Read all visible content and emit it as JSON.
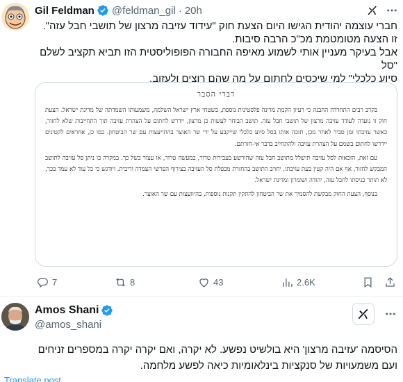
{
  "tweet1": {
    "author_name": "Gil Feldman",
    "handle": "@feldman_gil",
    "separator": "·",
    "time": "20h",
    "text_lines": [
      "חברי עוצמה יהודית הגישו היום הצעת חוק \"עידוד עזיבה מרצון של תושבי חבל עזה\".",
      "זו הצעה מטומטמת מכ\"כ הרבה סיבות.",
      "אבל בעיקר מעניין אותי לשמוע מאיפה החבורה הפופוליסטית הזו תביא תקציב לשלם \"סל",
      "סיוע כלכלי\" למי שיכסים לחתום על מה שהם רוצים ולעזוב."
    ],
    "document": {
      "title": "דברי הסבר",
      "paragraphs": [
        "בקרב רבים התחדדה ההבנה כי רעיון הקמת מדינה פלסטינית נוספת, בשטחי ארץ ישראל השלמה, משמעותו השמדתה של מדינת ישראל. הצעת חוק זו נועדה לעודד עזיבה מרצון של תושבי חבל עזה. תושב הבוחר לעשות כן מרצון, יידרש לחתום על הצהרת עזיבה תוך התחייבות שלא לחזור, כאשר עזיבתו זמן סביר לאחר מכן, תזכה אותו בסל סיוע כלכלי שייקבע על ידי שר האוצר בהתייעצות עם שר הביטחון. כמו כן, אחראים לקטינים יידרשו לחתום בשמם על הצהרת עזיבה ולהתחייב בדבר אי-חזרתם.",
        "עם זאת, הזכאות לסל עזיבה תישלל מתושב חבל עזה שהורשע בעבירות טרור, במעשה טרור, או עצור בשל כך. במקרה בו ניתן סל עזיבה לתושב המבקש לחזור, אף אם היה קטין בעת עזיבתו, יחויב התושב בהחזרת מכפלת סל העזיבה בצירוף הפרשי הצמדה וריבית. ויודגש כי כל עוד לא עמד בכך, לא תותר כניסתו לחבל עזה, יהודה ושומרון ומדינת ישראל.",
        "בנוסף, הצעת החוק מבקשת להסמיך את שר הביטחון להתקין תקנות נוספות, בהיוועצות עם שר האוצר."
      ]
    },
    "actions": {
      "replies": "7",
      "reposts": "8",
      "likes": "43",
      "views": "2.6K"
    }
  },
  "tweet2": {
    "author_name": "Amos Shani",
    "handle": "@amos_shani",
    "text_lines": [
      "הסיסמה 'עזיבה מרצון' היא בולשיט נפשע. לא יקרה, ואם יקרה יקרה במספרים זניחים",
      "ועם משמעויות של סנקציות בינלאומיות כיאה לפשע מלחמה."
    ],
    "translate_label": "Translate post"
  },
  "icons": {
    "verified": "verified-badge-icon",
    "grok": "grok-icon",
    "more": "more-options-icon",
    "reply": "reply-icon",
    "repost": "repost-icon",
    "like": "like-icon",
    "views": "views-icon",
    "bookmark": "bookmark-icon",
    "share": "share-icon"
  },
  "colors": {
    "verified_blue": "#1d9bf0",
    "secondary_text": "#536471",
    "link_blue": "#1d9bf0",
    "border": "#cfd9de"
  }
}
